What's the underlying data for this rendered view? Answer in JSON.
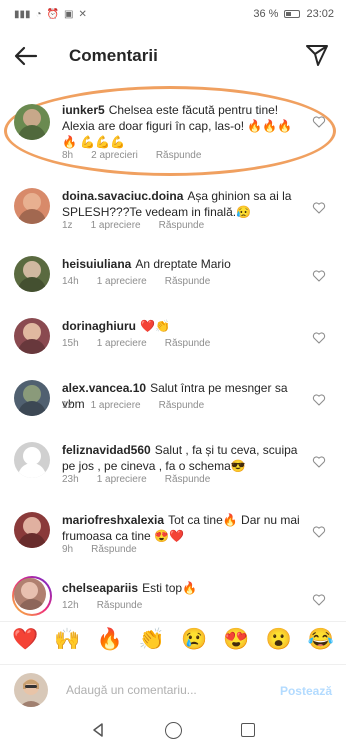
{
  "status_bar": {
    "battery_percent": "36 %",
    "time": "23:02"
  },
  "header": {
    "title": "Comentarii"
  },
  "comments": [
    {
      "username": "iunker5",
      "text": "Chelsea este făcută pentru tine! Alexia are doar figuri în cap, las-o! 🔥🔥🔥🔥 💪💪💪",
      "time": "8h",
      "likes": "2 aprecieri",
      "reply": "Răspunde",
      "avatar_colors": [
        "#6a8a50",
        "#c8a88a"
      ]
    },
    {
      "username": "doina.savaciuc.doina",
      "text": "Așa ghinion sa ai la SPLESH???Te vedeam in finală.😥",
      "time": "1z",
      "likes": "1 apreciere",
      "reply": "Răspunde",
      "avatar_colors": [
        "#d88a6a",
        "#e8b090"
      ]
    },
    {
      "username": "heisuiuliana",
      "text": "An dreptate Mario",
      "time": "14h",
      "likes": "1 apreciere",
      "reply": "Răspunde",
      "avatar_colors": [
        "#5a6a40",
        "#d0b8a0"
      ]
    },
    {
      "username": "dorinaghiuru",
      "text": "❤️👏",
      "time": "15h",
      "likes": "1 apreciere",
      "reply": "Răspunde",
      "avatar_colors": [
        "#8a4a50",
        "#e0b8a0"
      ]
    },
    {
      "username": "alex.vancea.10",
      "text": "Salut întra pe mesnger sa vbm",
      "time": "1z",
      "likes": "1 apreciere",
      "reply": "Răspunde",
      "avatar_colors": [
        "#506070",
        "#8a9a7a"
      ]
    },
    {
      "username": "feliznavidad560",
      "text": "Salut , fa și tu ceva, scuipa pe jos , pe cineva , fa o schema😎",
      "time": "23h",
      "likes": "1 apreciere",
      "reply": "Răspunde",
      "avatar_colors": [
        "#d0d0d0",
        "#ffffff"
      ]
    },
    {
      "username": "mariofreshxalexia",
      "text": "Tot ca tine🔥 Dar nu mai frumoasa ca tine 😍❤️",
      "time": "9h",
      "likes": "",
      "reply": "Răspunde",
      "avatar_colors": [
        "#8a3a3a",
        "#e0b0a0"
      ]
    },
    {
      "username": "chelseapariis",
      "text": "Esti top🔥",
      "time": "12h",
      "likes": "",
      "reply": "Răspunde",
      "avatar_colors": [
        "#b08070",
        "#e8c0b0"
      ]
    }
  ],
  "emoji_bar": [
    "❤️",
    "🙌",
    "🔥",
    "👏",
    "😢",
    "😍",
    "😮",
    "😂"
  ],
  "input": {
    "placeholder": "Adaugă un comentariu...",
    "post_label": "Postează"
  },
  "colors": {
    "highlight": "#f0a060",
    "post_disabled": "#b3dbff"
  }
}
